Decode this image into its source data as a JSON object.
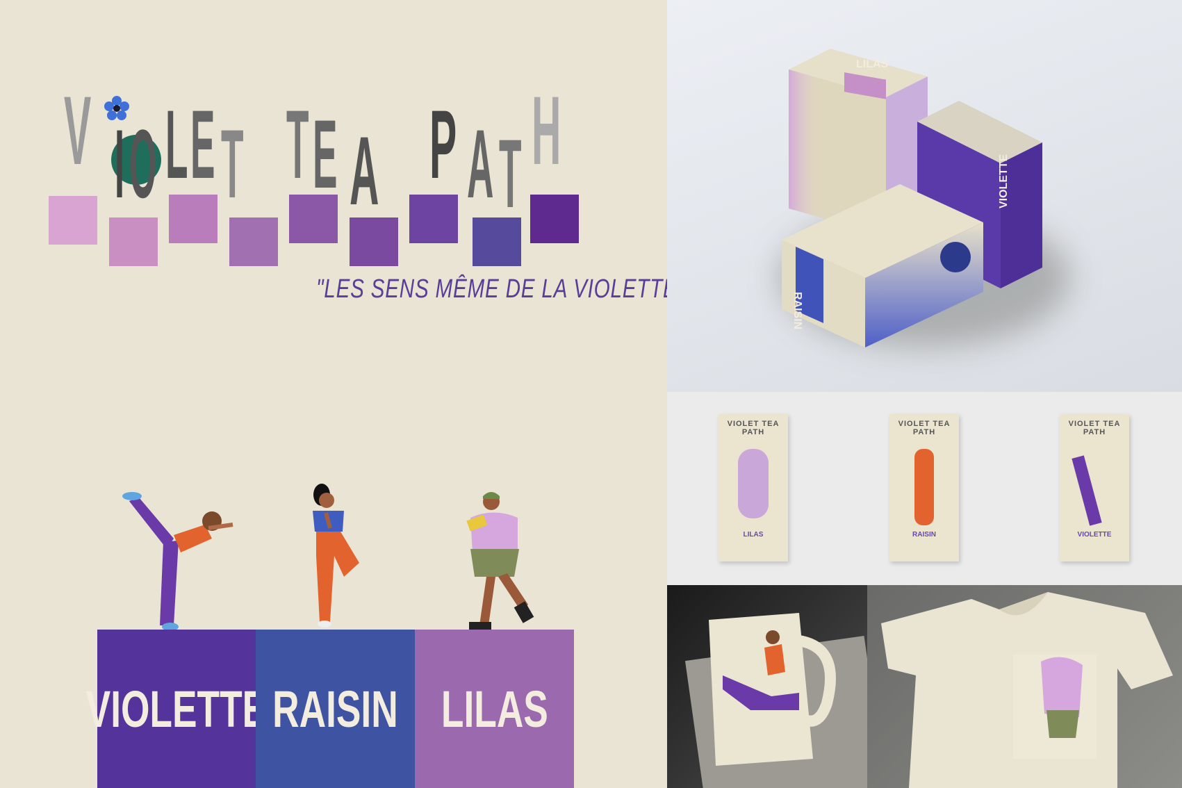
{
  "logo": {
    "letters": [
      "V",
      "I",
      "O",
      "L",
      "E",
      "T",
      "T",
      "E",
      "A",
      "P",
      "A",
      "T",
      "H"
    ]
  },
  "tagline": "\"LES SENS MÊME DE LA VIOLETTE\"",
  "flavors": [
    {
      "name": "VIOLETTE",
      "color": "#54349a"
    },
    {
      "name": "RAISIN",
      "color": "#3f53a3"
    },
    {
      "name": "LILAS",
      "color": "#9b6aae"
    }
  ],
  "palette": [
    "#d9a3d2",
    "#c98fc2",
    "#b87dba",
    "#a070b0",
    "#8a58a6",
    "#7a4aa0",
    "#6e44a3",
    "#554a9c",
    "#5e2a8f"
  ],
  "packaging": {
    "box_lilas_label": "LILAS",
    "box_raisin_label": "RAISIN",
    "box_violette_label": "VIOLETTE",
    "box_violette_spine": "VIOLETTE"
  },
  "cards": [
    {
      "name": "LILAS"
    },
    {
      "name": "RAISIN"
    },
    {
      "name": "VIOLETTE"
    }
  ]
}
